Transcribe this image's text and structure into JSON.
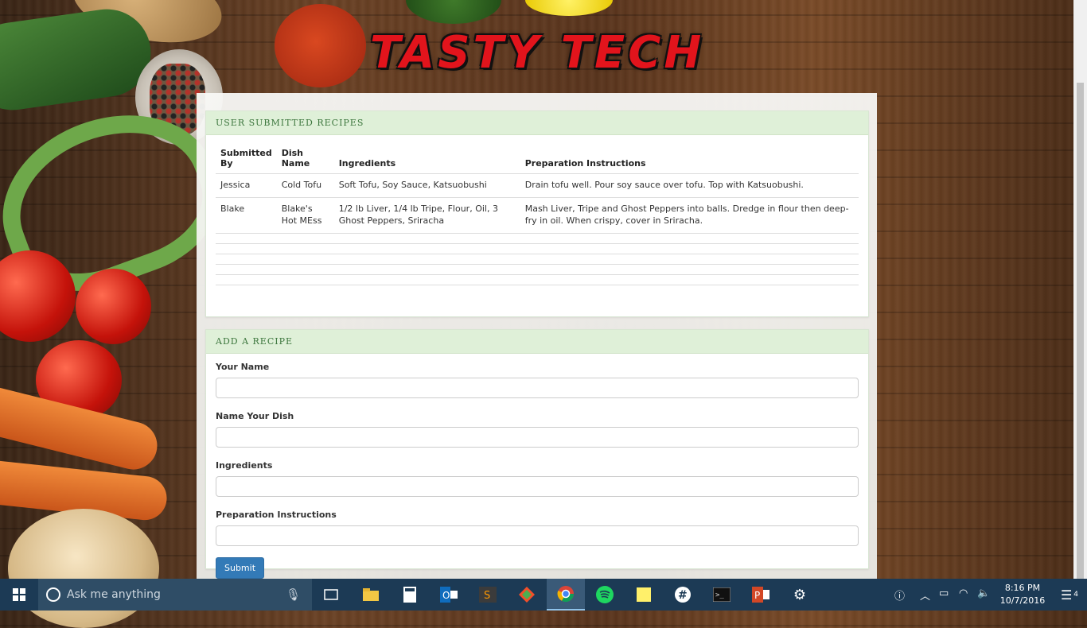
{
  "logo": {
    "text": "TASTY TECH"
  },
  "recipes": {
    "title": "USER SUBMITTED RECIPES",
    "headers": [
      "Submitted By",
      "Dish Name",
      "Ingredients",
      "Preparation Instructions"
    ],
    "rows": [
      {
        "submitted_by": "Jessica",
        "dish_name": "Cold Tofu",
        "ingredients": "Soft Tofu, Soy Sauce, Katsuobushi",
        "instructions": "Drain tofu well. Pour soy sauce over tofu. Top with Katsuobushi."
      },
      {
        "submitted_by": "Blake",
        "dish_name": "Blake's Hot MEss",
        "ingredients": "1/2 lb Liver, 1/4 lb Tripe, Flour, Oil, 3 Ghost Peppers, Sriracha",
        "instructions": "Mash Liver, Tripe and Ghost Peppers into balls. Dredge in flour then deep-fry in oil. When crispy, cover in Sriracha."
      }
    ]
  },
  "add_recipe": {
    "title": "ADD A RECIPE",
    "fields": {
      "name_label": "Your Name",
      "name_value": "",
      "dish_label": "Name Your Dish",
      "dish_value": "",
      "ingredients_label": "Ingredients",
      "ingredients_value": "",
      "instructions_label": "Preparation Instructions",
      "instructions_value": ""
    },
    "submit_label": "Submit"
  },
  "taskbar": {
    "search_placeholder": "Ask me anything",
    "apps": [
      "task-view",
      "file-explorer",
      "calculator",
      "outlook",
      "sublime-text",
      "git",
      "chrome",
      "spotify",
      "sticky-notes",
      "slack",
      "terminal",
      "powerpoint",
      "settings"
    ],
    "active_app": "chrome",
    "time": "8:16 PM",
    "date": "10/7/2016",
    "notification_count": "4"
  }
}
